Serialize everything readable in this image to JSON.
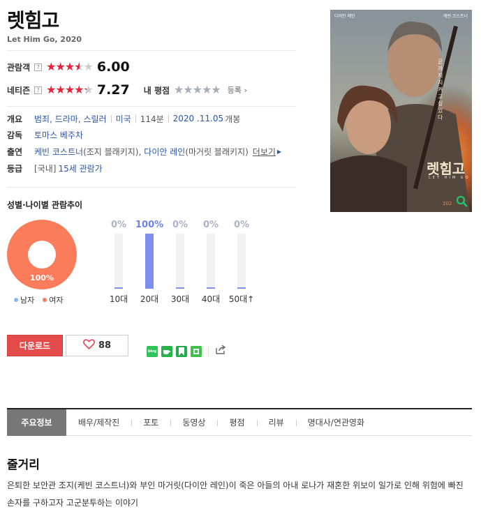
{
  "movie": {
    "title": "렛힘고",
    "subtitle": "Let Him Go, 2020"
  },
  "ratings": {
    "audience": {
      "label": "관람객",
      "score": "6.00",
      "stars_fraction": 0.6
    },
    "netizen": {
      "label": "네티즌",
      "score": "7.27",
      "stars_fraction": 0.727
    },
    "my_rating": {
      "label": "내 평점",
      "register": "등록"
    }
  },
  "info": {
    "overview_label": "개요",
    "genres": "범죄, 드라마, 스릴러",
    "country": "미국",
    "runtime": "114분",
    "release_date": "2020 .11.05",
    "release_suffix": "개봉",
    "director_label": "감독",
    "director": "토마스 베주차",
    "cast_label": "출연",
    "cast1": "케빈 코스트너",
    "cast1_role": "(조지 블래키지),",
    "cast2": "다이안 레인",
    "cast2_role": "(마거릿 블래키지)",
    "more": "더보기",
    "grade_label": "등급",
    "grade_region": "[국내]",
    "grade": "15세 관람가"
  },
  "demographics": {
    "title": "성별·나이별 관람추이",
    "gender": {
      "female_pct_label": "100%",
      "legend_male": "남자",
      "legend_female": "여자",
      "female_fraction": 1.0,
      "colors": {
        "male": "#8ab8ea",
        "female": "#fb7c5a"
      }
    },
    "age": [
      {
        "label": "10대",
        "pct": "0%",
        "value": 0
      },
      {
        "label": "20대",
        "pct": "100%",
        "value": 100
      },
      {
        "label": "30대",
        "pct": "0%",
        "value": 0
      },
      {
        "label": "40대",
        "pct": "0%",
        "value": 0
      },
      {
        "label": "50대↑",
        "pct": "0%",
        "value": 0
      }
    ]
  },
  "actions": {
    "download": "다운로드",
    "likes": "88",
    "share_blog": "blog"
  },
  "poster": {
    "top_left": "다이안 레인",
    "top_right": "케빈 코스트너",
    "tagline": "끝까지 지켜고 싶었다",
    "title": "렛힘고",
    "eng": "LET HIM GO",
    "year": "202"
  },
  "tabs": [
    "주요정보",
    "배우/제작진",
    "포토",
    "동영상",
    "평점",
    "리뷰",
    "명대사/연관영화"
  ],
  "synopsis": {
    "title": "줄거리",
    "text": "은퇴한 보안관 조지(케빈 코스트너)와 부인 마거릿(다이안 레인)이 죽은 아들의 아내 로나가 재혼한 위보이 일가로 인해 위험에 빠진 손자를 구하고자 고군분투하는 이야기"
  }
}
